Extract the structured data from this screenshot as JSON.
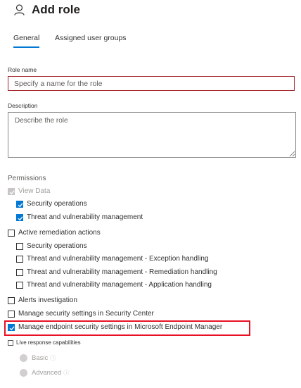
{
  "header": {
    "title": "Add role",
    "icon": "person-icon"
  },
  "tabs": [
    {
      "label": "General",
      "active": true
    },
    {
      "label": "Assigned user groups",
      "active": false
    }
  ],
  "role_name": {
    "label": "Role name",
    "placeholder": "Specify a name for the role",
    "value": ""
  },
  "description": {
    "label": "Description",
    "placeholder": "Describe the role",
    "value": ""
  },
  "permissions": {
    "label": "Permissions",
    "view_data": {
      "label": "View Data",
      "checked": true,
      "disabled": true,
      "children": [
        {
          "label": "Security operations",
          "checked": true
        },
        {
          "label": "Threat and vulnerability management",
          "checked": true
        }
      ]
    },
    "active_remediation": {
      "label": "Active remediation actions",
      "checked": false,
      "children": [
        {
          "label": "Security operations",
          "checked": false
        },
        {
          "label": "Threat and vulnerability management - Exception handling",
          "checked": false
        },
        {
          "label": "Threat and vulnerability management - Remediation handling",
          "checked": false
        },
        {
          "label": "Threat and vulnerability management - Application handling",
          "checked": false
        }
      ]
    },
    "alerts_investigation": {
      "label": "Alerts investigation",
      "checked": false
    },
    "manage_security_settings": {
      "label": "Manage security settings in Security Center",
      "checked": false
    },
    "manage_endpoint_security": {
      "label": "Manage endpoint security settings in Microsoft Endpoint Manager",
      "checked": true,
      "highlighted": true
    },
    "live_response": {
      "label": "Live response capabilities",
      "checked": false,
      "options": [
        {
          "label": "Basic",
          "info": "ⓘ",
          "disabled": true
        },
        {
          "label": "Advanced",
          "info": "ⓘ",
          "disabled": true
        }
      ]
    }
  },
  "colors": {
    "accent": "#0078d4",
    "error_border": "#a4262c",
    "highlight": "#e81123"
  }
}
